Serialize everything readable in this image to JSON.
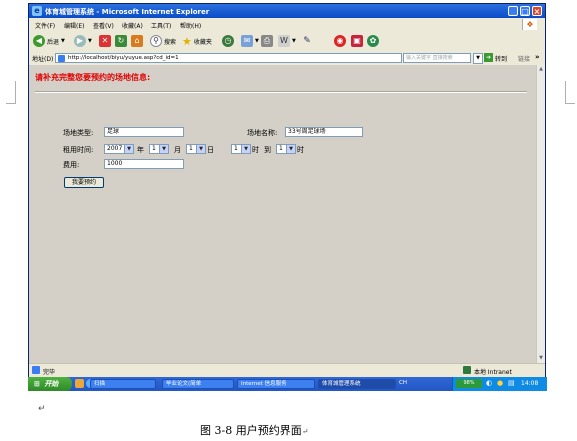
{
  "window": {
    "title": "体育城管理系统 - Microsoft Internet Explorer",
    "controls": [
      "_",
      "□",
      "×"
    ]
  },
  "menu": [
    "文件(F)",
    "编辑(E)",
    "查看(V)",
    "收藏(A)",
    "工具(T)",
    "帮助(H)"
  ],
  "toolbar": {
    "back": "后退",
    "search": "搜索",
    "favorites": "收藏夹"
  },
  "address": {
    "label": "地址(D)",
    "url": "http://localhost/biyu/yuyue.asp?cd_id=1",
    "search_placeholder": "输入关键字 直接搜索",
    "go": "转到",
    "links": "链接"
  },
  "page": {
    "heading": "请补充完整您要预约的场地信息:",
    "venue_type_label": "场地类型:",
    "venue_type_value": "足球",
    "venue_name_label": "场地名称:",
    "venue_name_value": "33号周足球场",
    "rent_time_label": "租用时间:",
    "year_value": "2007",
    "year_unit": "年",
    "month_value": "1",
    "month_unit": "月",
    "day_value": "1",
    "day_unit": "日",
    "hour_from_value": "1",
    "hour_unit": "时",
    "to_label": "到",
    "hour_to_value": "1",
    "hour_to_unit": "时",
    "fee_label": "费用:",
    "fee_value": "1000",
    "submit_label": "我要预约"
  },
  "status": {
    "left": "完毕",
    "zone": "本地 Intranet"
  },
  "taskbar": {
    "start": "开始",
    "tasks": [
      "扫描",
      "毕业论文(简单",
      "Internet 信息服务",
      "体育城管理系统"
    ],
    "ime": "CH",
    "battery": "98%",
    "clock": "14:08"
  },
  "caption": "图 3-8 用户预约界面"
}
